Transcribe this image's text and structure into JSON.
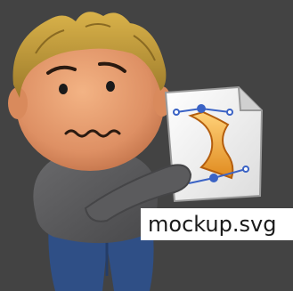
{
  "colors": {
    "background": "#434343",
    "hair": "#c9a23a",
    "skin": "#e2976a",
    "shirt": "#59595b",
    "jeans": "#2f4f86",
    "label_bg": "#ffffff"
  },
  "file": {
    "name": "mockup.svg",
    "icon": "svg-file-icon"
  },
  "character": {
    "icon": "worried-person-illustration"
  }
}
